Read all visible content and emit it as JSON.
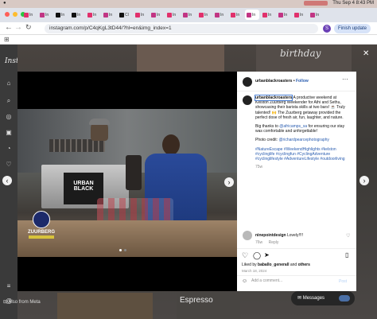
{
  "menubar": {
    "date_time": "Thu Sep 4  8:43 PM"
  },
  "tabs": [
    {
      "label": "In"
    },
    {
      "label": "In"
    },
    {
      "label": "In"
    },
    {
      "label": "In"
    },
    {
      "label": "In"
    },
    {
      "label": "In"
    },
    {
      "label": "Cl"
    },
    {
      "label": "In"
    },
    {
      "label": "In"
    },
    {
      "label": "In"
    },
    {
      "label": "In"
    },
    {
      "label": "In"
    },
    {
      "label": "In"
    },
    {
      "label": "In"
    },
    {
      "label": "In"
    },
    {
      "label": "In"
    },
    {
      "label": "In"
    },
    {
      "label": "In"
    },
    {
      "label": "In"
    }
  ],
  "browser": {
    "url": "instagram.com/p/C4qKgL3tD44/?hl=en&img_index=1",
    "profile_initial": "S",
    "finish_update": "Finish update"
  },
  "sidebar": {
    "logo": "Instagram",
    "also_from_meta": "Also from Meta"
  },
  "photo": {
    "sign_brand_top": "URBAN",
    "sign_brand_bottom": "BLACK",
    "event_logo": "ZUURBERG"
  },
  "post": {
    "header_user": "urbanblackroasters",
    "follow": "Follow",
    "caption_user": "urbanblackroasters",
    "caption_p1": "A productive weekend at Kelston Zuurberg Weekender for Athi and Sethu, showcasing their barista skills at two bars! ☕ Truly talented! 🙌 The Zuurberg getaway provided the perfect dose of fresh air, fun, laughter, and nature.",
    "caption_p2_prefix": "Big thanks to ",
    "caption_p2_mention": "@africamps_sa",
    "caption_p2_suffix": " for ensuring our stay was comfortable and unforgettable!",
    "photo_credit_prefix": "Photo credit: ",
    "photo_credit_mention": "@richardpearcephotography",
    "hashtags": "#NatureEscape #WeekendHighlights #kelston #cyclinglife #cyclingfun #CyclingAdventure #cyclinglifestyle #AdventureLifestyle #outdoorliving",
    "caption_age": "75w",
    "comment_user": "ninepointdesign",
    "comment_text": "Lovely!!!!",
    "comment_age": "76w",
    "comment_reply": "Reply",
    "liked_by_prefix": "Liked by ",
    "liked_by_user": "baballo_generall",
    "liked_by_suffix": " and ",
    "liked_by_others": "others",
    "date": "March 18, 2024",
    "add_comment_placeholder": "Add a comment...",
    "post_button": "Post"
  },
  "messages": {
    "label": "Messages"
  },
  "background_cards": {
    "birthday_script": "birthday",
    "espresso": "Espresso"
  }
}
